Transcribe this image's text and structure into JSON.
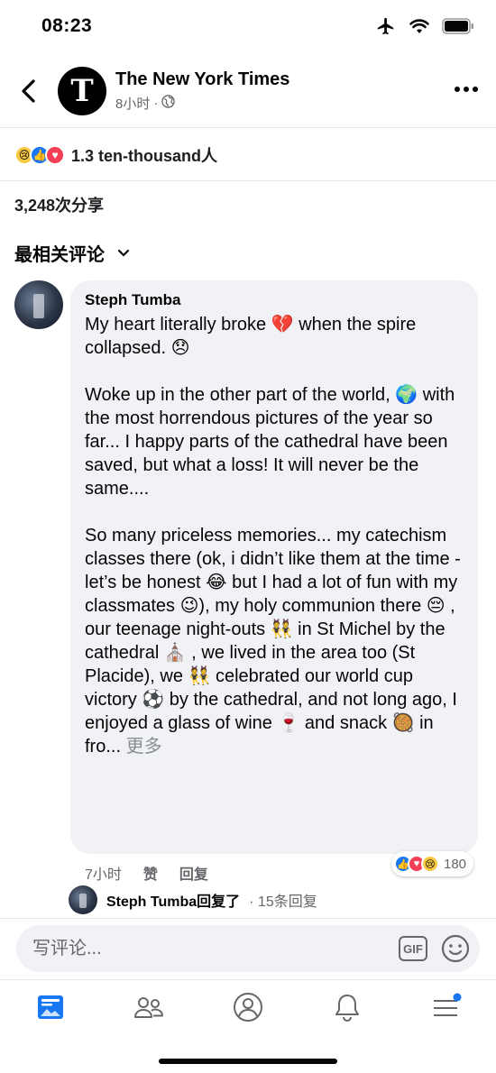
{
  "status_bar": {
    "time": "08:23"
  },
  "header": {
    "page_name": "The New York Times",
    "timestamp": "8小时",
    "separator": "·",
    "logo_glyph": "T"
  },
  "post": {
    "reaction_count": "1.3 ten-thousand人",
    "share_count": "3,248次分享",
    "sort_label": "最相关评论"
  },
  "comment": {
    "author": "Steph Tumba",
    "text": "My heart literally broke 💔 when the spire collapsed. 😞\n\nWoke up in the other part of the world, 🌍 with the most horrendous pictures of the year so far... I happy parts of the cathedral have been saved, but what a loss! It will never be the same....\n\nSo many priceless memories... my catechism classes there (ok, i didn’t like them at the time - let’s be honest 😂 but I had a lot of fun with my classmates 😉), my holy communion there 😔 , our teenage night-outs 👯 in St Michel by the cathedral ⛪ , we lived in the area too (St Placide), we 👯 celebrated our world cup victory ⚽ by the cathedral, and not long ago, I enjoyed a glass of wine 🍷 and snack 🥘 in fro...",
    "see_more": "更多",
    "time": "7小时",
    "like_label": "赞",
    "reply_label": "回复",
    "reaction_count": "180"
  },
  "reply_preview": {
    "name": "Steph Tumba回复了",
    "count": "· 15条回复"
  },
  "composer": {
    "placeholder": "写评论...",
    "gif_label": "GIF"
  },
  "tabbar": {
    "tabs": [
      "news-feed-icon",
      "groups-icon",
      "profile-icon",
      "notifications-icon",
      "menu-icon"
    ],
    "accent": "#1877f2"
  },
  "colors": {
    "like_blue": "#1877f2",
    "love_red": "#f33e58",
    "sad_yellow": "#f7c840",
    "bubble_bg": "#f0f2f5",
    "secondary_text": "#65676b"
  }
}
